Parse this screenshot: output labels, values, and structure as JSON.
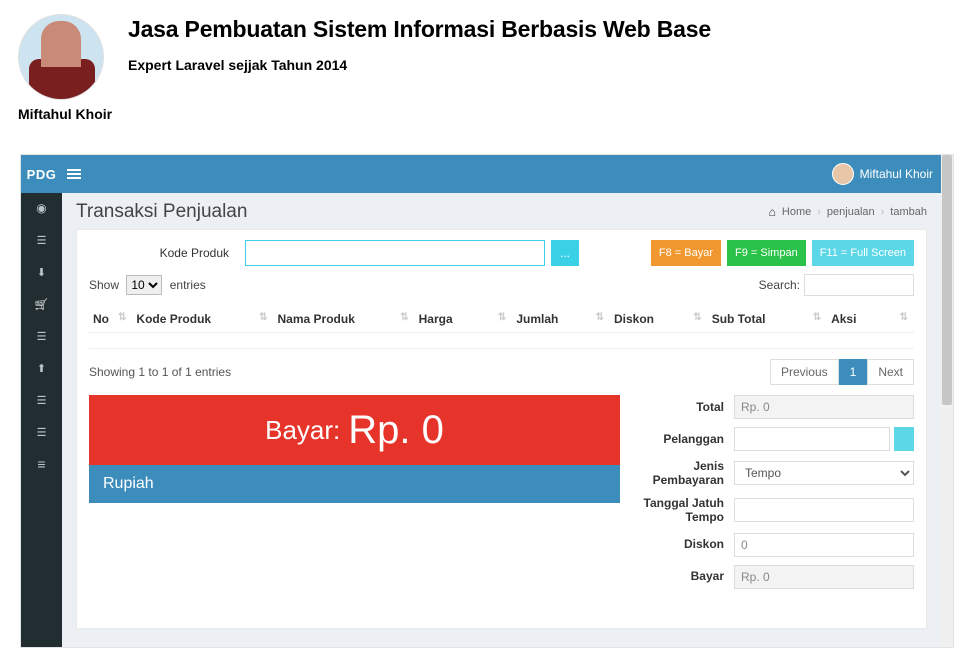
{
  "header": {
    "title": "Jasa Pembuatan Sistem Informasi Berbasis Web Base",
    "subtitle": "Expert Laravel sejjak Tahun 2014",
    "author": "Miftahul Khoir"
  },
  "topbar": {
    "brand": "PDG",
    "user_name": "Miftahul Khoir"
  },
  "page": {
    "title": "Transaksi Penjualan",
    "breadcrumb": {
      "home": "Home",
      "mid": "penjualan",
      "leaf": "tambah"
    }
  },
  "product_row": {
    "label": "Kode Produk",
    "input_value": "",
    "dots": "...",
    "btn_bayar": "F8 = Bayar",
    "btn_simpan": "F9 = Simpan",
    "btn_full": "F11 = Full Screen"
  },
  "datatable": {
    "show_label_pre": "Show",
    "show_value": "10",
    "show_label_post": "entries",
    "search_label": "Search:",
    "search_value": "",
    "columns": [
      "No",
      "Kode Produk",
      "Nama Produk",
      "Harga",
      "Jumlah",
      "Diskon",
      "Sub Total",
      "Aksi"
    ],
    "info": "Showing 1 to 1 of 1 entries",
    "pager": {
      "prev": "Previous",
      "page": "1",
      "next": "Next"
    }
  },
  "display": {
    "bayar_prefix": "Bayar:",
    "bayar_amount": "Rp. 0",
    "currency_word": "Rupiah"
  },
  "form": {
    "total": {
      "label": "Total",
      "value": "Rp. 0"
    },
    "pelanggan": {
      "label": "Pelanggan",
      "value": ""
    },
    "jenis": {
      "label": "Jenis Pembayaran",
      "value": "Tempo"
    },
    "jatuh": {
      "label": "Tanggal Jatuh Tempo",
      "value": ""
    },
    "diskon": {
      "label": "Diskon",
      "value": "0"
    },
    "bayar": {
      "label": "Bayar",
      "value": "Rp. 0"
    }
  }
}
